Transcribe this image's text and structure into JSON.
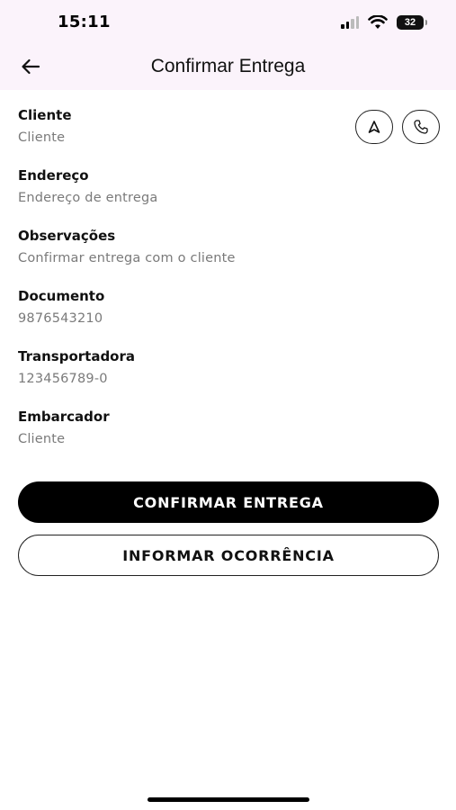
{
  "status_bar": {
    "time": "15:11",
    "battery_level": "32",
    "icons": [
      "cellular-signal-icon",
      "wifi-icon",
      "battery-icon"
    ]
  },
  "header": {
    "title": "Confirmar Entrega",
    "back_icon": "arrow-left-icon"
  },
  "actions": {
    "navigate_icon": "navigation-arrow-icon",
    "call_icon": "phone-icon"
  },
  "fields": [
    {
      "label": "Cliente",
      "value": "Cliente"
    },
    {
      "label": "Endereço",
      "value": "Endereço de entrega"
    },
    {
      "label": "Observações",
      "value": "Confirmar entrega com o cliente"
    },
    {
      "label": "Documento",
      "value": "9876543210"
    },
    {
      "label": "Transportadora",
      "value": "123456789-0"
    },
    {
      "label": "Embarcador",
      "value": "Cliente"
    }
  ],
  "buttons": {
    "confirm_label": "CONFIRMAR ENTREGA",
    "report_label": "INFORMAR OCORRÊNCIA"
  },
  "colors": {
    "header_background": "#fbf3fb",
    "primary_button": "#000000",
    "value_text": "#7a7a7a"
  }
}
